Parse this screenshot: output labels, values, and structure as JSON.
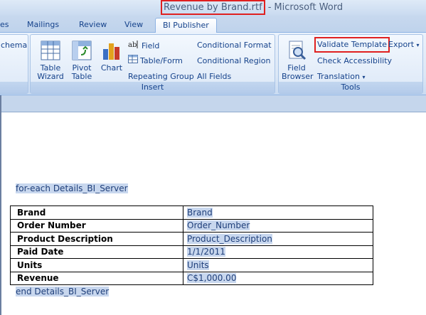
{
  "window": {
    "document_name": "Revenue by Brand.rtf",
    "separator": "-",
    "app_name": "Microsoft Word"
  },
  "tabs": [
    {
      "label": "es"
    },
    {
      "label": "Mailings"
    },
    {
      "label": "Review"
    },
    {
      "label": "View"
    },
    {
      "label": "BI Publisher",
      "active": true
    }
  ],
  "ribbon": {
    "left_cut_label": "chema",
    "insert_group": {
      "label": "Insert",
      "table_wizard": "Table\nWizard",
      "pivot_table": "Pivot\nTable",
      "chart": "Chart",
      "field": "Field",
      "table_form": "Table/Form",
      "repeating_group": "Repeating Group",
      "conditional_format": "Conditional Format",
      "conditional_region": "Conditional Region",
      "all_fields": "All Fields"
    },
    "tools_group": {
      "label": "Tools",
      "field_browser": "Field\nBrowser",
      "validate_template": "Validate Template",
      "check_accessibility": "Check Accessibility",
      "translation": "Translation",
      "export": "Export"
    },
    "icons": {
      "table_wizard": "table-wizard-icon",
      "pivot_table": "pivot-table-icon",
      "chart": "chart-icon",
      "field": "field-icon",
      "table_form": "table-form-icon",
      "field_browser": "field-browser-icon"
    }
  },
  "document": {
    "loop_start": "for-each Details_BI_Server",
    "loop_end": "end Details_BI_Server",
    "rows": [
      {
        "label": "Brand",
        "value": "Brand"
      },
      {
        "label": "Order Number",
        "value": "Order_Number"
      },
      {
        "label": "Product Description",
        "value": "Product_Description"
      },
      {
        "label": "Paid Date",
        "value": "1/1/2011"
      },
      {
        "label": "Units",
        "value": "Units"
      },
      {
        "label": "Revenue",
        "value": "C$1,000.00"
      }
    ]
  },
  "colors": {
    "highlight_border": "#e02020",
    "field_shading": "#c8d7ee",
    "ribbon_text": "#15428b"
  }
}
